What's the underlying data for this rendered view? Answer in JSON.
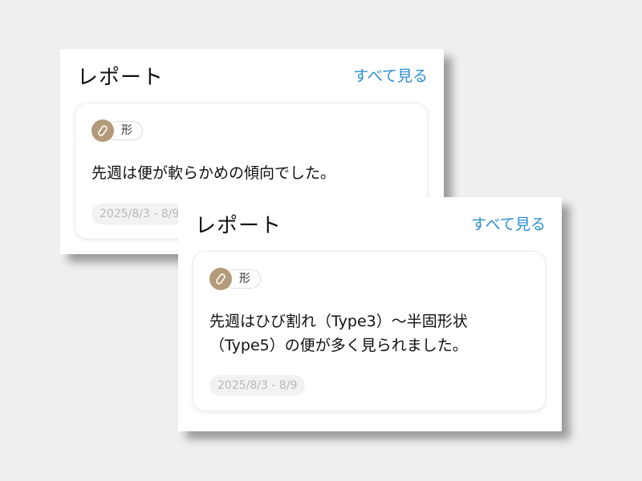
{
  "reports": [
    {
      "title": "レポート",
      "see_all": "すべて見る",
      "card": {
        "tag_icon": "stool-icon",
        "tag_label": "形",
        "text": "先週は便が軟らかめの傾向でした。",
        "date_range": "2025/8/3 - 8/9"
      }
    },
    {
      "title": "レポート",
      "see_all": "すべて見る",
      "card": {
        "tag_icon": "stool-icon",
        "tag_label": "形",
        "text": "先週はひび割れ（Type3）〜半固形状（Type5）の便が多く見られました。",
        "date_range": "2025/8/3 - 8/9"
      }
    }
  ],
  "colors": {
    "accent_link": "#2b8fd0",
    "tag_icon_bg": "#b39a79",
    "background": "#efefef"
  }
}
